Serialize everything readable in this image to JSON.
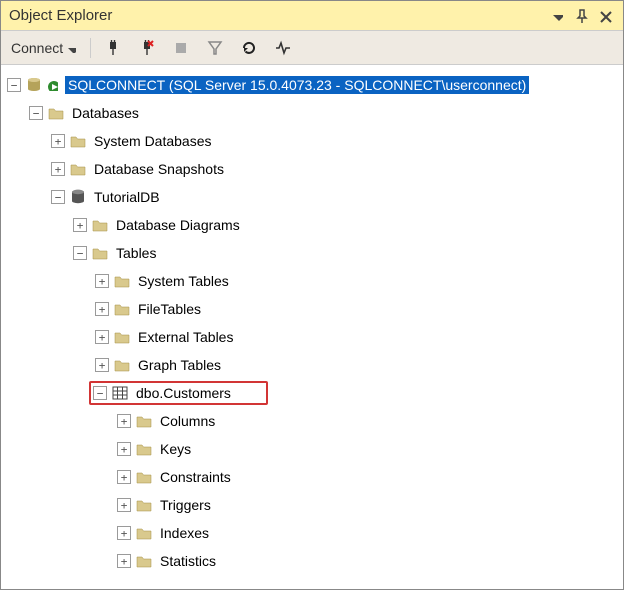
{
  "window": {
    "title": "Object Explorer"
  },
  "toolbar": {
    "connect_label": "Connect"
  },
  "tree": {
    "server": "SQLCONNECT (SQL Server 15.0.4073.23 - SQLCONNECT\\userconnect)",
    "databases": "Databases",
    "system_databases": "System Databases",
    "database_snapshots": "Database Snapshots",
    "tutorialdb": "TutorialDB",
    "database_diagrams": "Database Diagrams",
    "tables": "Tables",
    "system_tables": "System Tables",
    "filetables": "FileTables",
    "external_tables": "External Tables",
    "graph_tables": "Graph Tables",
    "customers": "dbo.Customers",
    "columns": "Columns",
    "keys": "Keys",
    "constraints": "Constraints",
    "triggers": "Triggers",
    "indexes": "Indexes",
    "statistics": "Statistics"
  }
}
